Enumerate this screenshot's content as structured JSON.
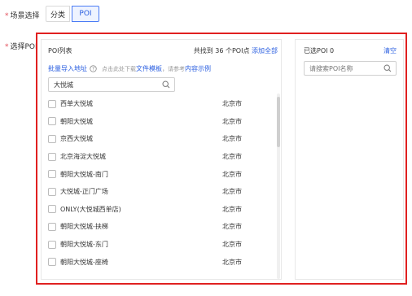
{
  "scene": {
    "label": "场景选择",
    "options": [
      {
        "label": "分类",
        "active": false
      },
      {
        "label": "POI",
        "active": true
      }
    ]
  },
  "select_poi": {
    "label": "选择POI"
  },
  "poi_list": {
    "title": "POI列表",
    "count_text": "共找到 36 个POI点",
    "add_all": "添加全部",
    "batch_import": "批量导入地址",
    "hint_prefix": "点击此处下载",
    "template_link": "文件模板",
    "hint_mid": "，请参考",
    "example_link": "内容示例",
    "search_value": "大悦城",
    "items": [
      {
        "name": "西单大悦城",
        "city": "北京市"
      },
      {
        "name": "朝阳大悦城",
        "city": "北京市"
      },
      {
        "name": "京西大悦城",
        "city": "北京市"
      },
      {
        "name": "北京海淀大悦城",
        "city": "北京市"
      },
      {
        "name": "朝阳大悦城-南门",
        "city": "北京市"
      },
      {
        "name": "大悦城-正门广场",
        "city": "北京市"
      },
      {
        "name": "ONLY(大悦城西单店)",
        "city": "北京市"
      },
      {
        "name": "朝阳大悦城-扶梯",
        "city": "北京市"
      },
      {
        "name": "朝阳大悦城-东门",
        "city": "北京市"
      },
      {
        "name": "朝阳大悦城-座椅",
        "city": "北京市"
      }
    ]
  },
  "selected": {
    "title": "已选POI 0",
    "clear": "清空",
    "search_placeholder": "请搜索POI名称"
  },
  "colors": {
    "accent": "#2b5fe0",
    "highlight_frame": "#e02020",
    "required": "#e34d59"
  }
}
